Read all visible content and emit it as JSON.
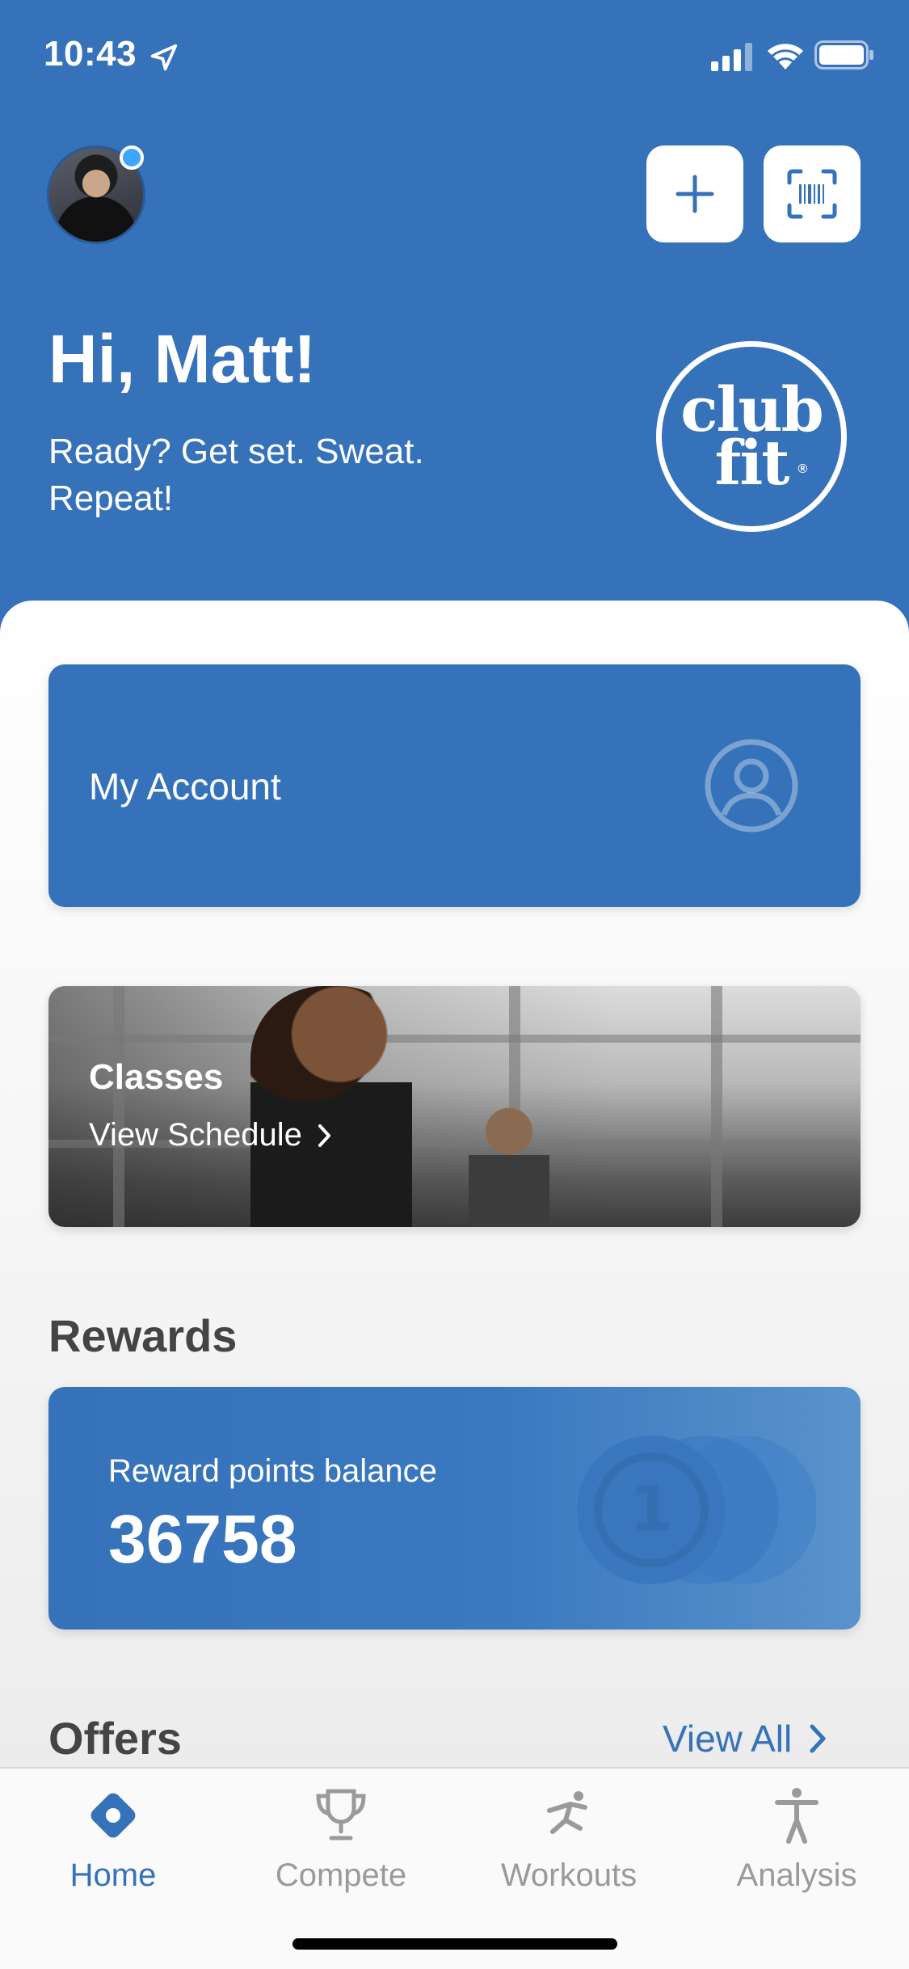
{
  "status_bar": {
    "time": "10:43",
    "location_icon": "location-arrow-icon",
    "signal_icon": "cellular-signal-icon",
    "wifi_icon": "wifi-icon",
    "battery_icon": "battery-icon"
  },
  "header": {
    "greeting": "Hi, Matt!",
    "tagline": "Ready? Get set. Sweat. Repeat!",
    "logo_line1": "club",
    "logo_line2": "fit",
    "logo_mark": "®",
    "add_icon": "plus-icon",
    "scan_icon": "barcode-scan-icon",
    "avatar_status_color": "#3ea6ff"
  },
  "account_card": {
    "label": "My Account",
    "icon": "user-circle-icon"
  },
  "classes_card": {
    "title": "Classes",
    "subtitle": "View Schedule",
    "chevron": "›"
  },
  "rewards": {
    "heading": "Rewards",
    "balance_label": "Reward points balance",
    "balance_value": "36758",
    "coin_glyph": "1"
  },
  "offers": {
    "heading": "Offers",
    "view_all": "View All",
    "chevron": "›"
  },
  "tabs": [
    {
      "label": "Home",
      "icon": "home-diamond-icon",
      "active": true
    },
    {
      "label": "Compete",
      "icon": "trophy-icon",
      "active": false
    },
    {
      "label": "Workouts",
      "icon": "running-figure-icon",
      "active": false
    },
    {
      "label": "Analysis",
      "icon": "person-standing-icon",
      "active": false
    }
  ],
  "colors": {
    "brand_blue": "#3572b9",
    "inactive_gray": "#9a9a9a",
    "heading_gray": "#444444"
  }
}
